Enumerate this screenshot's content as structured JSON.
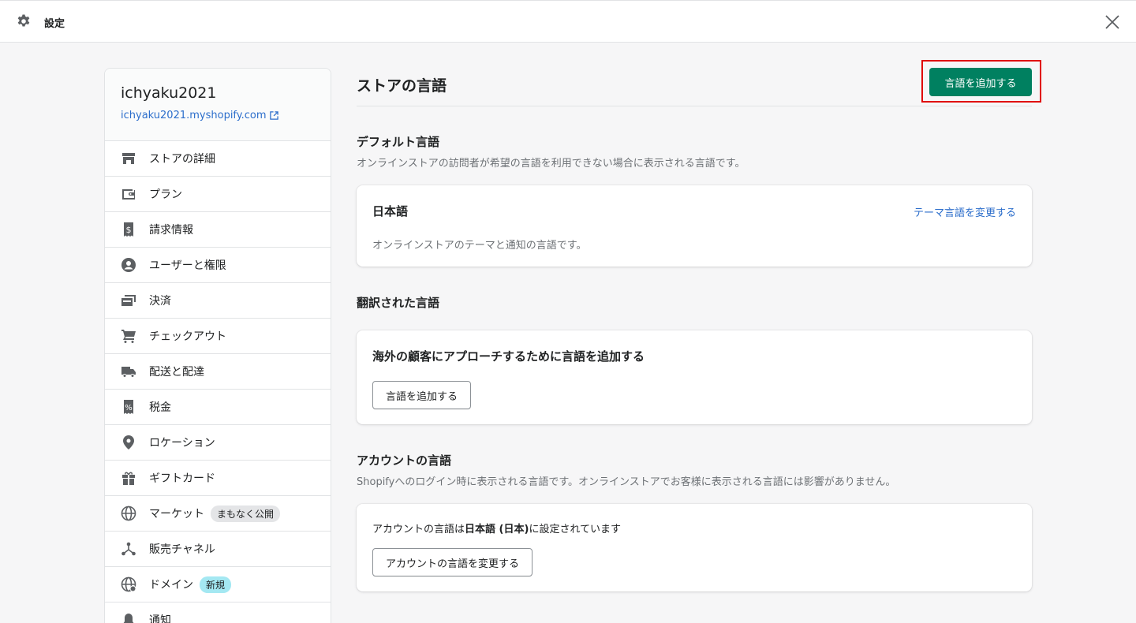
{
  "topbar": {
    "title": "設定"
  },
  "sidebar": {
    "store_name": "ichyaku2021",
    "store_url": "ichyaku2021.myshopify.com",
    "items": [
      {
        "label": "ストアの詳細",
        "icon": "store-icon"
      },
      {
        "label": "プラン",
        "icon": "wallet-icon"
      },
      {
        "label": "請求情報",
        "icon": "receipt-dollar-icon"
      },
      {
        "label": "ユーザーと権限",
        "icon": "user-circle-icon"
      },
      {
        "label": "決済",
        "icon": "payments-icon"
      },
      {
        "label": "チェックアウト",
        "icon": "cart-icon"
      },
      {
        "label": "配送と配達",
        "icon": "truck-icon"
      },
      {
        "label": "税金",
        "icon": "tax-receipt-icon"
      },
      {
        "label": "ロケーション",
        "icon": "location-pin-icon"
      },
      {
        "label": "ギフトカード",
        "icon": "gift-icon"
      },
      {
        "label": "マーケット",
        "icon": "globe-icon",
        "badge": "まもなく公開"
      },
      {
        "label": "販売チャネル",
        "icon": "channels-icon"
      },
      {
        "label": "ドメイン",
        "icon": "domain-globe-icon",
        "badge": "新規"
      },
      {
        "label": "通知",
        "icon": "bell-icon"
      }
    ]
  },
  "main": {
    "title": "ストアの言語",
    "add_language_button": "言語を追加する",
    "default_language": {
      "heading": "デフォルト言語",
      "description": "オンラインストアの訪問者が希望の言語を利用できない場合に表示される言語です。",
      "card_title": "日本語",
      "card_link": "テーマ言語を変更する",
      "card_text": "オンラインストアのテーマと通知の言語です。"
    },
    "translated_languages": {
      "heading": "翻訳された言語",
      "card_title": "海外の顧客にアプローチするために言語を追加する",
      "card_button": "言語を追加する"
    },
    "account_language": {
      "heading": "アカウントの言語",
      "description": "Shopifyへのログイン時に表示される言語です。オンラインストアでお客様に表示される言語には影響がありません。",
      "line_prefix": "アカウントの言語は",
      "line_value": "日本語 (日本)",
      "line_suffix": "に設定されています",
      "button": "アカウントの言語を変更する"
    }
  },
  "colors": {
    "primary": "#008060",
    "link": "#2c6ecb",
    "highlight": "#e00000"
  }
}
